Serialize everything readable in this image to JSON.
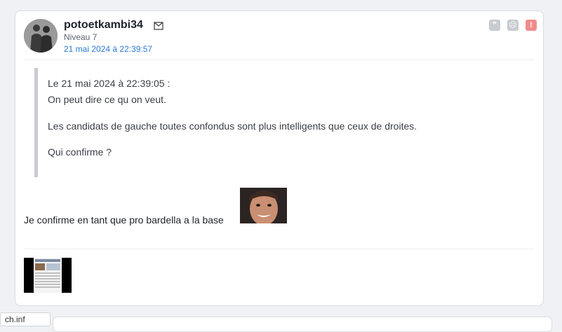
{
  "post": {
    "author": "potoetkambi34",
    "level": "Niveau 7",
    "date": "21 mai 2024 à 22:39:57",
    "avatar_icon": "avatar-silhouettes",
    "actions": [
      "quote-icon",
      "sad-face-icon",
      "alert-icon"
    ],
    "actions_glyphs": {
      "quote": "❞",
      "sad": "☹",
      "alert": "!"
    },
    "quote": {
      "header": "Le 21 mai 2024 à 22:39:05 :",
      "line1": "On peut dire ce qu on veut.",
      "line2": "Les candidats de gauche toutes confondus sont plus intelligents que ceux de droites.",
      "line3": "Qui confirme ?"
    },
    "reply_text": "Je confirme en tant que pro bardella a la base",
    "sticker_icon": "smiling-man-sticker",
    "thumbnail_icon": "newspaper-thumbnail"
  },
  "colors": {
    "accent": "#2a7ad6",
    "alert": "#f08d8d",
    "icon_gray": "#c8cbd0"
  },
  "tooltip": "ch.inf"
}
